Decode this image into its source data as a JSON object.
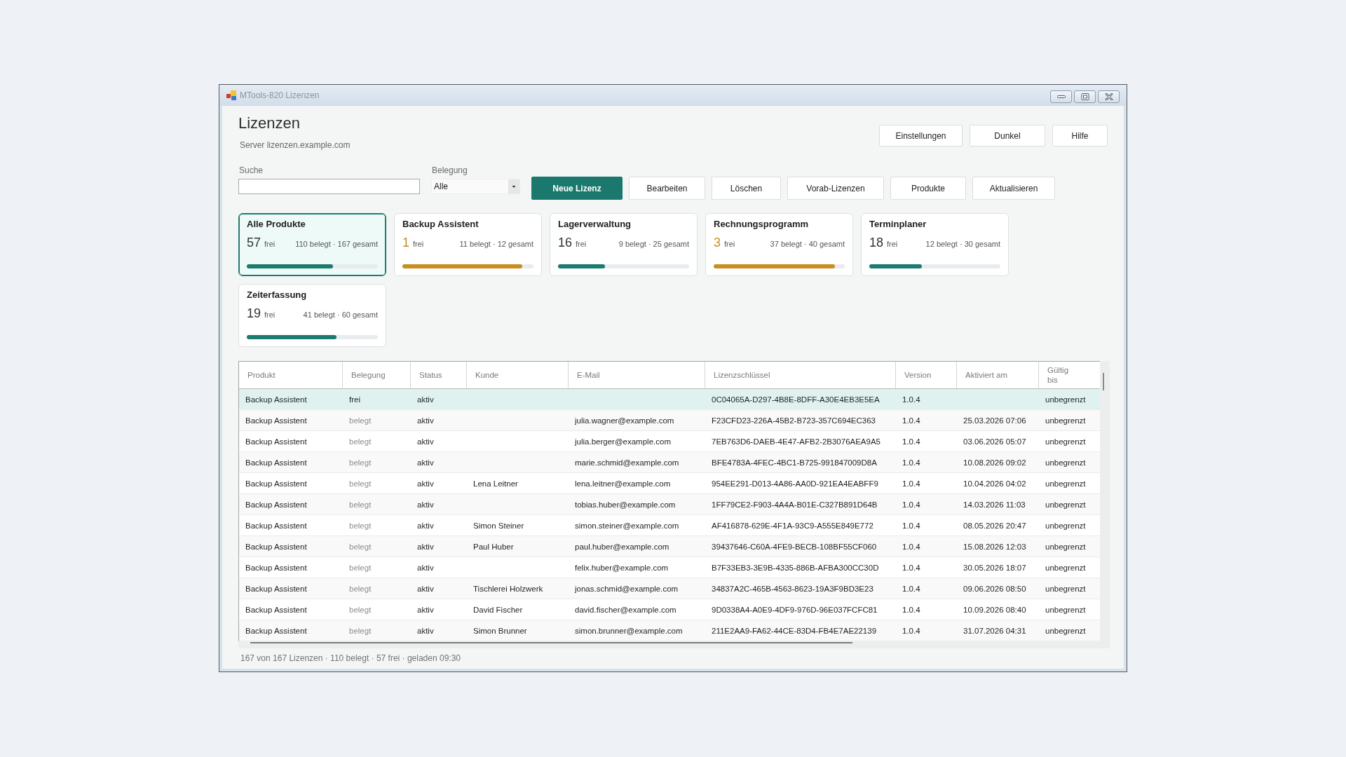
{
  "window": {
    "title": "MTools-820 Lizenzen"
  },
  "header": {
    "title": "Lizenzen",
    "server": "Server lizenzen.example.com",
    "buttons": [
      "Einstellungen",
      "Dunkel",
      "Hilfe"
    ]
  },
  "filters": {
    "search": {
      "label": "Suche"
    },
    "occupancy": {
      "label": "Belegung",
      "value": "Alle"
    }
  },
  "toolbar": {
    "buttons": [
      {
        "label": "Neue Lizenz",
        "primary": true
      },
      {
        "label": "Bearbeiten",
        "primary": false
      },
      {
        "label": "Löschen",
        "primary": false
      },
      {
        "label": "Vorab-Lizenzen",
        "primary": false
      },
      {
        "label": "Produkte",
        "primary": false
      },
      {
        "label": "Aktualisieren",
        "primary": false
      }
    ]
  },
  "product_cards": [
    {
      "name": "Alle Produkte",
      "free": "57",
      "free_label": "frei",
      "summary": "110 belegt · 167 gesamt",
      "level": 0.66,
      "warning": false,
      "selected": true
    },
    {
      "name": "Backup Assistent",
      "free": "1",
      "free_label": "frei",
      "summary": "11 belegt · 12 gesamt",
      "level": 0.917,
      "warning": true,
      "selected": false
    },
    {
      "name": "Lagerverwaltung",
      "free": "16",
      "free_label": "frei",
      "summary": "9 belegt · 25 gesamt",
      "level": 0.36,
      "warning": false,
      "selected": false
    },
    {
      "name": "Rechnungsprogramm",
      "free": "3",
      "free_label": "frei",
      "summary": "37 belegt · 40 gesamt",
      "level": 0.925,
      "warning": true,
      "selected": false
    },
    {
      "name": "Terminplaner",
      "free": "18",
      "free_label": "frei",
      "summary": "12 belegt · 30 gesamt",
      "level": 0.4,
      "warning": false,
      "selected": false
    },
    {
      "name": "Zeiterfassung",
      "free": "19",
      "free_label": "frei",
      "summary": "41 belegt · 60 gesamt",
      "level": 0.683,
      "warning": false,
      "selected": false
    }
  ],
  "table": {
    "columns": [
      "Produkt",
      "Belegung",
      "Status",
      "Kunde",
      "E-Mail",
      "Lizenzschlüssel",
      "Version",
      "Aktiviert am",
      "Gültig bis"
    ],
    "rows": [
      {
        "product": "Backup Assistent",
        "assignment": "frei",
        "status": "aktiv",
        "key": "0C04065A-D297-4B8E-8DFF-A30E4EB3E5EA",
        "version": "1.0.4",
        "valid_until": "unbegrenzt",
        "assigned": false,
        "selected": true
      },
      {
        "product": "Backup Assistent",
        "assignment": "belegt",
        "status": "aktiv",
        "email": "julia.wagner@example.com",
        "key": "F23CFD23-226A-45B2-B723-357C694EC363",
        "version": "1.0.4",
        "activated": "25.03.2026 07:06",
        "valid_until": "unbegrenzt",
        "assigned": true,
        "selected": false
      },
      {
        "product": "Backup Assistent",
        "assignment": "belegt",
        "status": "aktiv",
        "email": "julia.berger@example.com",
        "key": "7EB763D6-DAEB-4E47-AFB2-2B3076AEA9A5",
        "version": "1.0.4",
        "activated": "03.06.2026 05:07",
        "valid_until": "unbegrenzt",
        "assigned": true,
        "selected": false
      },
      {
        "product": "Backup Assistent",
        "assignment": "belegt",
        "status": "aktiv",
        "email": "marie.schmid@example.com",
        "key": "BFE4783A-4FEC-4BC1-B725-991847009D8A",
        "version": "1.0.4",
        "activated": "10.08.2026 09:02",
        "valid_until": "unbegrenzt",
        "assigned": true,
        "selected": false
      },
      {
        "product": "Backup Assistent",
        "assignment": "belegt",
        "status": "aktiv",
        "customer": "Lena Leitner",
        "email": "lena.leitner@example.com",
        "key": "954EE291-D013-4A86-AA0D-921EA4EABFF9",
        "version": "1.0.4",
        "activated": "10.04.2026 04:02",
        "valid_until": "unbegrenzt",
        "assigned": true,
        "selected": false
      },
      {
        "product": "Backup Assistent",
        "assignment": "belegt",
        "status": "aktiv",
        "email": "tobias.huber@example.com",
        "key": "1FF79CE2-F903-4A4A-B01E-C327B891D64B",
        "version": "1.0.4",
        "activated": "14.03.2026 11:03",
        "valid_until": "unbegrenzt",
        "assigned": true,
        "selected": false
      },
      {
        "product": "Backup Assistent",
        "assignment": "belegt",
        "status": "aktiv",
        "customer": "Simon Steiner",
        "email": "simon.steiner@example.com",
        "key": "AF416878-629E-4F1A-93C9-A555E849E772",
        "version": "1.0.4",
        "activated": "08.05.2026 20:47",
        "valid_until": "unbegrenzt",
        "assigned": true,
        "selected": false
      },
      {
        "product": "Backup Assistent",
        "assignment": "belegt",
        "status": "aktiv",
        "customer": "Paul Huber",
        "email": "paul.huber@example.com",
        "key": "39437646-C60A-4FE9-BECB-108BF55CF060",
        "version": "1.0.4",
        "activated": "15.08.2026 12:03",
        "valid_until": "unbegrenzt",
        "assigned": true,
        "selected": false
      },
      {
        "product": "Backup Assistent",
        "assignment": "belegt",
        "status": "aktiv",
        "email": "felix.huber@example.com",
        "key": "B7F33EB3-3E9B-4335-886B-AFBA300CC30D",
        "version": "1.0.4",
        "activated": "30.05.2026 18:07",
        "valid_until": "unbegrenzt",
        "assigned": true,
        "selected": false
      },
      {
        "product": "Backup Assistent",
        "assignment": "belegt",
        "status": "aktiv",
        "customer": "Tischlerei Holzwerk",
        "email": "jonas.schmid@example.com",
        "key": "34837A2C-465B-4563-8623-19A3F9BD3E23",
        "version": "1.0.4",
        "activated": "09.06.2026 08:50",
        "valid_until": "unbegrenzt",
        "assigned": true,
        "selected": false
      },
      {
        "product": "Backup Assistent",
        "assignment": "belegt",
        "status": "aktiv",
        "customer": "David Fischer",
        "email": "david.fischer@example.com",
        "key": "9D0338A4-A0E9-4DF9-976D-96E037FCFC81",
        "version": "1.0.4",
        "activated": "10.09.2026 08:40",
        "valid_until": "unbegrenzt",
        "assigned": true,
        "selected": false
      },
      {
        "product": "Backup Assistent",
        "assignment": "belegt",
        "status": "aktiv",
        "customer": "Simon Brunner",
        "email": "simon.brunner@example.com",
        "key": "211E2AA9-FA62-44CE-83D4-FB4E7AE22139",
        "version": "1.0.4",
        "activated": "31.07.2026 04:31",
        "valid_until": "unbegrenzt",
        "assigned": true,
        "selected": false
      }
    ]
  },
  "status_bar": "167 von 167 Lizenzen · 110 belegt · 57 frei · geladen 09:30"
}
